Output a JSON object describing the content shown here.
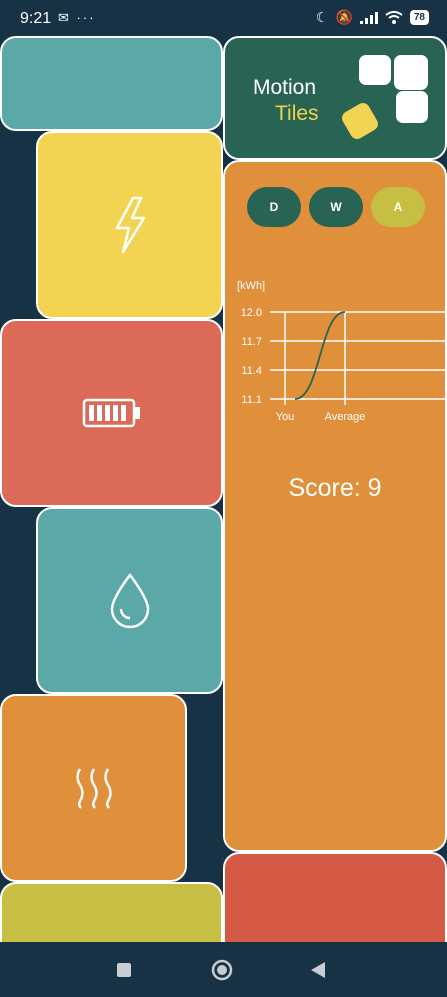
{
  "status_bar": {
    "time": "9:21",
    "left_icons": [
      "notification-icon",
      "more-dots-icon"
    ],
    "right_icons": [
      "moon-icon",
      "mute-icon",
      "signal-icon",
      "wifi-icon"
    ],
    "battery": "78"
  },
  "logo": {
    "line1": "Motion",
    "line2": "Tiles"
  },
  "tiles": [
    {
      "id": "energy",
      "icon": "lightning-icon"
    },
    {
      "id": "battery",
      "icon": "battery-icon"
    },
    {
      "id": "water",
      "icon": "water-drop-icon"
    },
    {
      "id": "heat",
      "icon": "heat-icon"
    }
  ],
  "period_tabs": [
    {
      "label": "D",
      "active": false
    },
    {
      "label": "W",
      "active": false
    },
    {
      "label": "A",
      "active": true
    }
  ],
  "chart_data": {
    "type": "line",
    "ylabel": "[kWh]",
    "categories": [
      "You",
      "Average"
    ],
    "yticks": [
      12.0,
      11.7,
      11.4,
      11.1
    ],
    "ylim": [
      11.1,
      12.0
    ],
    "series": [
      {
        "values": [
          11.1,
          12.0
        ]
      }
    ]
  },
  "score": {
    "text": "Score: 9"
  },
  "colors": {
    "background": "#173145",
    "teal": "#5aa8a8",
    "yellow": "#f3d352",
    "red": "#dc6a58",
    "orange": "#e08f3a",
    "olive": "#c6bf43",
    "dark_green": "#286354"
  },
  "nav_bar": [
    "square-icon",
    "circle-icon",
    "back-triangle-icon"
  ]
}
